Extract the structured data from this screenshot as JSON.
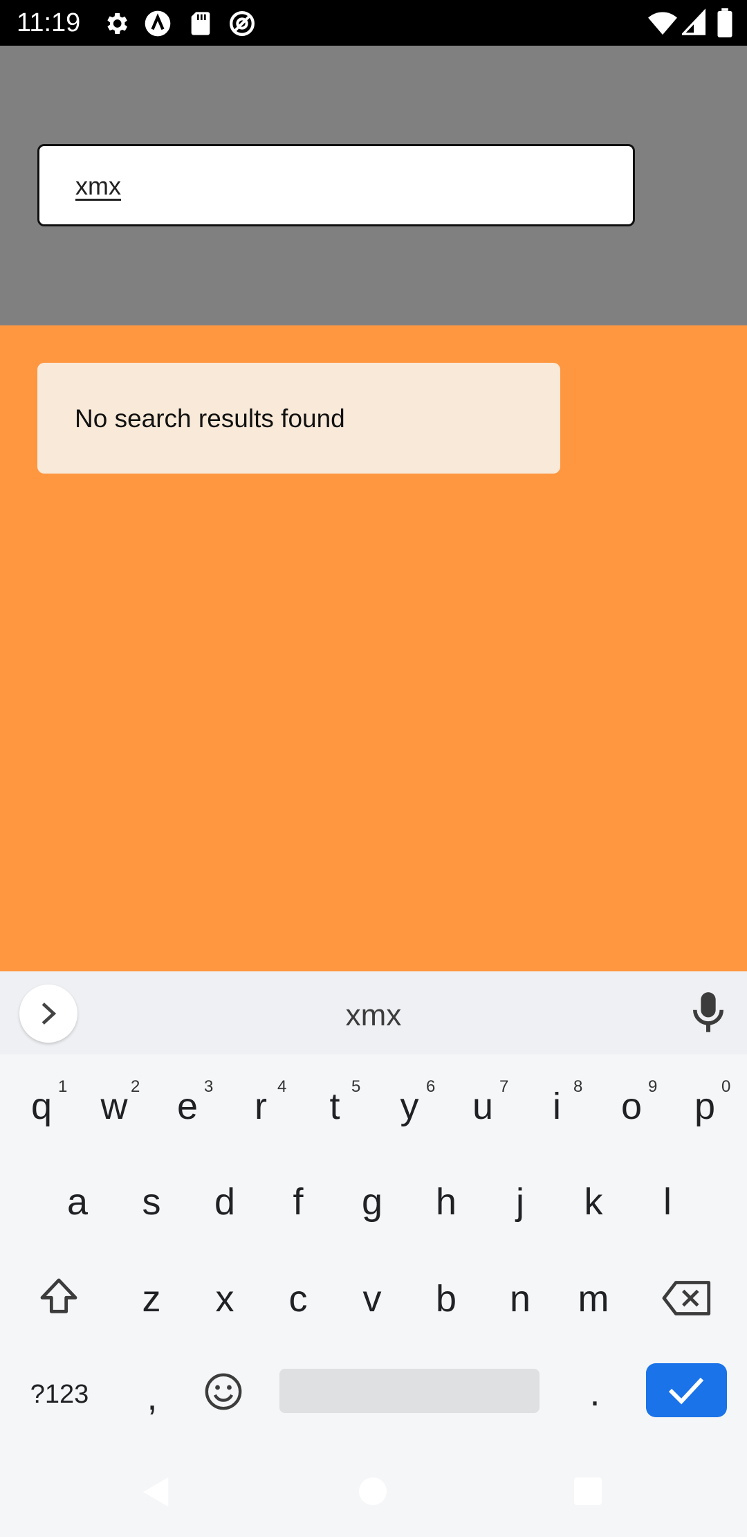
{
  "status_bar": {
    "time": "11:19",
    "left_icons": [
      "gear-icon",
      "a-circle-icon",
      "sd-card-icon",
      "at-circle-icon"
    ],
    "right_icons": [
      "wifi-icon",
      "signal-icon",
      "battery-icon"
    ]
  },
  "search": {
    "value": "xmx"
  },
  "results": {
    "message": "No search results found"
  },
  "keyboard": {
    "suggestion": "xmx",
    "row1": [
      {
        "key": "q",
        "sup": "1"
      },
      {
        "key": "w",
        "sup": "2"
      },
      {
        "key": "e",
        "sup": "3"
      },
      {
        "key": "r",
        "sup": "4"
      },
      {
        "key": "t",
        "sup": "5"
      },
      {
        "key": "y",
        "sup": "6"
      },
      {
        "key": "u",
        "sup": "7"
      },
      {
        "key": "i",
        "sup": "8"
      },
      {
        "key": "o",
        "sup": "9"
      },
      {
        "key": "p",
        "sup": "0"
      }
    ],
    "row2": [
      "a",
      "s",
      "d",
      "f",
      "g",
      "h",
      "j",
      "k",
      "l"
    ],
    "row3": [
      "z",
      "x",
      "c",
      "v",
      "b",
      "n",
      "m"
    ],
    "symbols_label": "?123",
    "comma": ",",
    "period": "."
  },
  "colors": {
    "header_bg": "#808080",
    "content_bg": "#ff9640",
    "card_bg": "#f9e9d8",
    "enter_key": "#1a73e8"
  }
}
